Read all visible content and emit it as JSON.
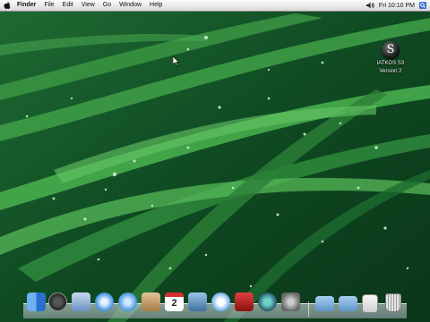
{
  "menubar": {
    "app_name": "Finder",
    "menus": [
      "File",
      "Edit",
      "View",
      "Go",
      "Window",
      "Help"
    ],
    "clock": "Fri 10:10 PM"
  },
  "desktop_icon": {
    "glyph": "S",
    "label_line1": "iATKOS S3",
    "label_line2": "Version 2"
  },
  "dock": {
    "calendar_day": "2",
    "items": [
      "finder-icon",
      "dashboard-icon",
      "mail-icon",
      "safari-icon",
      "ichat-icon",
      "address-book-icon",
      "ical-icon",
      "preview-icon",
      "itunes-icon",
      "photo-booth-icon",
      "time-machine-icon",
      "system-preferences-icon",
      "applications-folder-icon",
      "documents-folder-icon",
      "downloads-stack-icon",
      "trash-icon"
    ]
  }
}
